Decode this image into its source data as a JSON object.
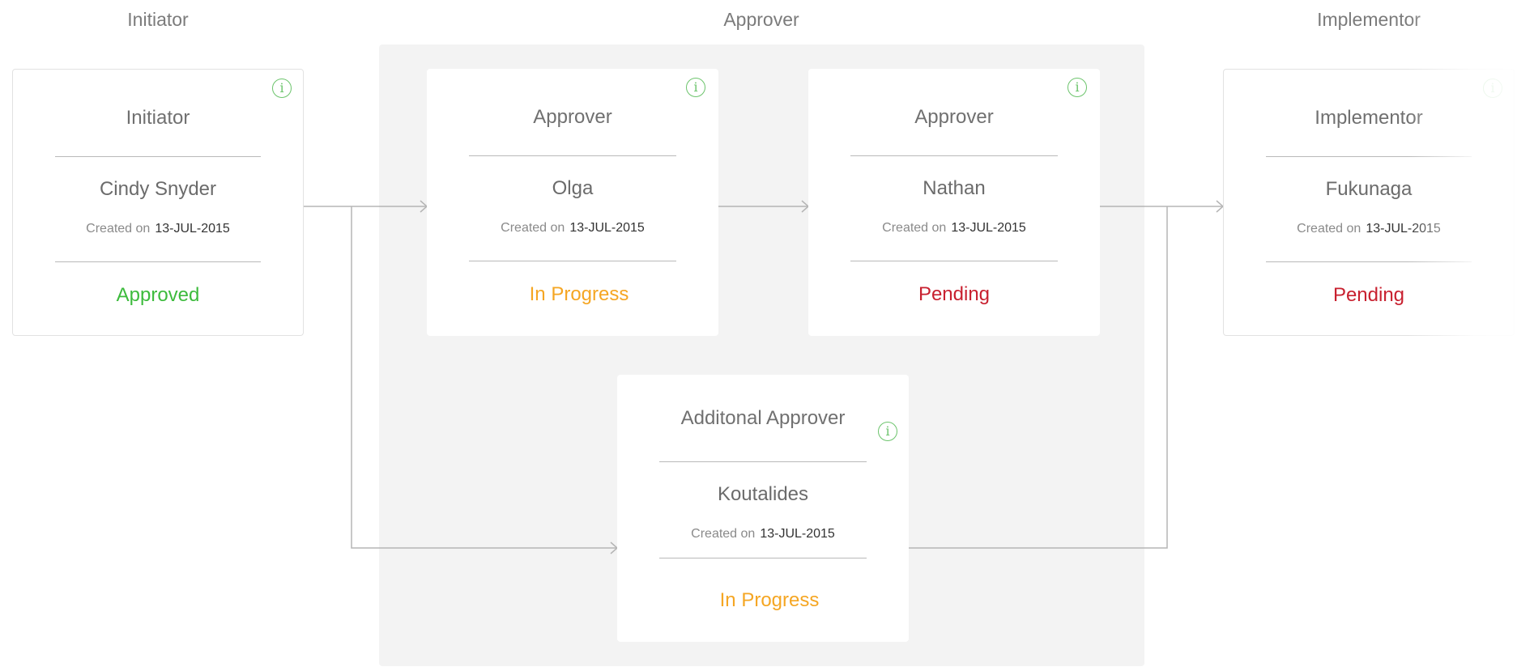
{
  "columns": {
    "initiator": "Initiator",
    "approver": "Approver",
    "implementor": "Implementor"
  },
  "cards": {
    "initiator": {
      "role": "Initiator",
      "person": "Cindy Snyder",
      "created_label": "Created on",
      "created_date": "13-JUL-2015",
      "status": "Approved",
      "status_color": "#3dbb3d"
    },
    "approver1": {
      "role": "Approver",
      "person": "Olga",
      "created_label": "Created on",
      "created_date": "13-JUL-2015",
      "status": "In Progress",
      "status_color": "#f5a623"
    },
    "approver2": {
      "role": "Approver",
      "person": "Nathan",
      "created_label": "Created on",
      "created_date": "13-JUL-2015",
      "status": "Pending",
      "status_color": "#c8202f"
    },
    "additional": {
      "role": "Additonal Approver",
      "person": "Koutalides",
      "created_label": "Created on",
      "created_date": "13-JUL-2015",
      "status": "In Progress",
      "status_color": "#f5a623"
    },
    "implementor": {
      "role": "Implementor",
      "person": "Fukunaga",
      "created_label": "Created on",
      "created_date": "13-JUL-2015",
      "status": "Pending",
      "status_color": "#c8202f"
    }
  },
  "icons": {
    "info": "info-circle-icon",
    "info_glyph": "i"
  },
  "colors": {
    "info_icon": "#6cc46c",
    "connector": "#b5b5b5",
    "group_background": "#f3f3f3"
  }
}
